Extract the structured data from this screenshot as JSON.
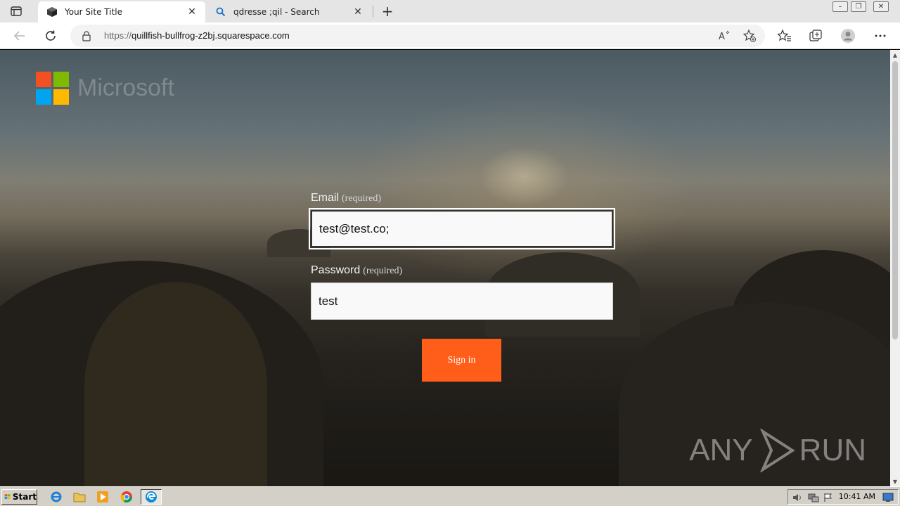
{
  "browser": {
    "tabs": [
      {
        "title": "Your Site Title",
        "active": true
      },
      {
        "title": "qdresse ;qil - Search",
        "active": false
      }
    ],
    "address": {
      "scheme": "https://",
      "host": "quillfish-bullfrog-z2bj.squarespace.com"
    }
  },
  "page": {
    "logo_text": "Microsoft",
    "email": {
      "label": "Email",
      "required": "(required)",
      "value": "test@test.co;"
    },
    "password": {
      "label": "Password",
      "required": "(required)",
      "value": "test"
    },
    "signin_label": "Sign in",
    "watermark": {
      "left": "ANY",
      "right": "RUN"
    },
    "logo_colors": [
      "#f25022",
      "#7fba00",
      "#00a4ef",
      "#ffb900"
    ],
    "accent": "#ff5e1a"
  },
  "taskbar": {
    "start_label": "Start",
    "clock": "10:41 AM"
  }
}
